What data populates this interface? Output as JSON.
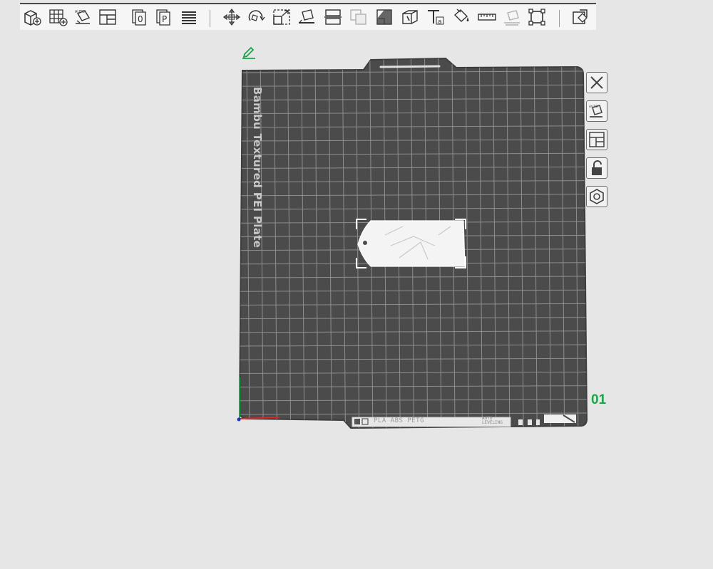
{
  "colors": {
    "accent": "#1aa548",
    "plate": "#4b4b4b",
    "grid": "#8e8e8e",
    "background": "#e6e6e6",
    "axis_x": "#d62828",
    "axis_y": "#1aa548",
    "axis_z": "#2030c0"
  },
  "toolbar": {
    "items": [
      {
        "name": "add-object-icon"
      },
      {
        "name": "add-plate-icon"
      },
      {
        "name": "auto-orient-icon"
      },
      {
        "name": "arrange-icon"
      },
      {
        "name": "split-objects-icon"
      },
      {
        "name": "split-parts-icon"
      },
      {
        "name": "variable-layer-height-icon"
      },
      {
        "name": "move-icon"
      },
      {
        "name": "rotate-icon"
      },
      {
        "name": "scale-icon"
      },
      {
        "name": "lay-on-face-icon"
      },
      {
        "name": "cut-icon"
      },
      {
        "name": "boolean-icon"
      },
      {
        "name": "support-paint-icon"
      },
      {
        "name": "seam-paint-icon"
      },
      {
        "name": "text-icon"
      },
      {
        "name": "color-paint-icon"
      },
      {
        "name": "measure-icon"
      },
      {
        "name": "assembly-icon"
      },
      {
        "name": "fit-view-icon"
      },
      {
        "name": "search-tool-icon"
      }
    ]
  },
  "plate": {
    "label": "Bambu Textured PEI Plate",
    "number": "01",
    "filament_info": "PLA ABS PETG",
    "auto_line1": "AUTO",
    "auto_line2": "LEVELING"
  },
  "side_toolbar": {
    "items": [
      {
        "name": "close-plate-icon"
      },
      {
        "name": "orient-plate-icon"
      },
      {
        "name": "arrange-plate-icon"
      },
      {
        "name": "lock-plate-icon"
      },
      {
        "name": "plate-settings-icon"
      }
    ]
  }
}
